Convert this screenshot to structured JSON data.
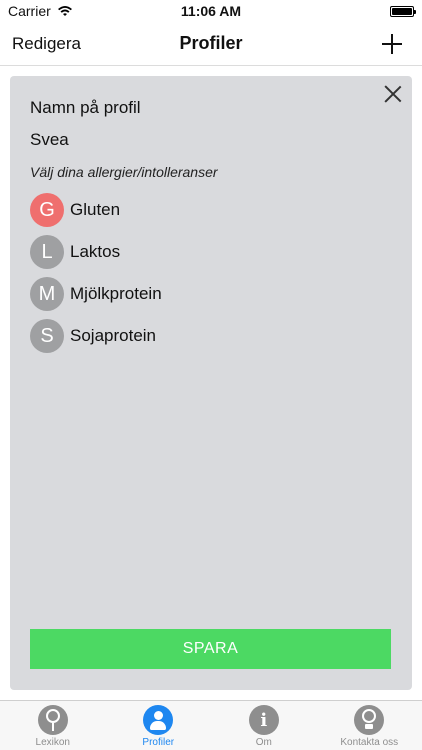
{
  "status_bar": {
    "carrier": "Carrier",
    "time": "11:06 AM"
  },
  "nav": {
    "left_label": "Redigera",
    "title": "Profiler"
  },
  "form": {
    "name_label": "Namn på profil",
    "name_value": "Svea",
    "allergy_hint": "Välj dina allergier/intolleranser",
    "allergies": [
      {
        "letter": "G",
        "label": "Gluten",
        "selected": true
      },
      {
        "letter": "L",
        "label": "Laktos",
        "selected": false
      },
      {
        "letter": "M",
        "label": "Mjölkprotein",
        "selected": false
      },
      {
        "letter": "S",
        "label": "Sojaprotein",
        "selected": false
      }
    ],
    "save_label": "SPARA"
  },
  "tabs": [
    {
      "label": "Lexikon",
      "icon": "magnifier-icon",
      "active": false
    },
    {
      "label": "Profiler",
      "icon": "person-icon",
      "active": true
    },
    {
      "label": "Om",
      "icon": "info-icon",
      "active": false
    },
    {
      "label": "Kontakta oss",
      "icon": "lightbulb-icon",
      "active": false
    }
  ],
  "colors": {
    "selected_badge": "#ef6f6e",
    "badge": "#9fa0a2",
    "save_button": "#4cd963",
    "tab_active": "#1e87f0",
    "card_background": "#d9dadd"
  }
}
